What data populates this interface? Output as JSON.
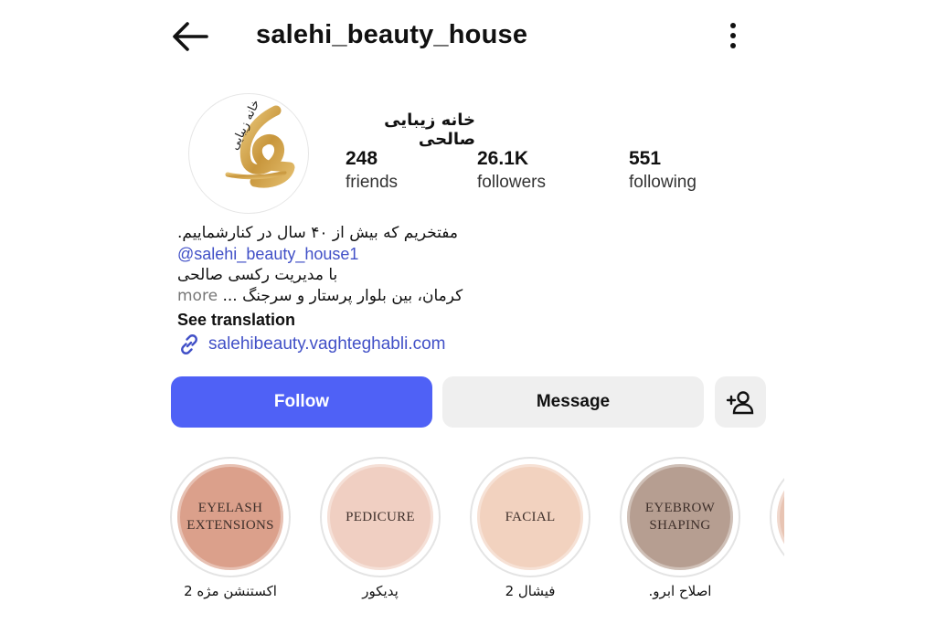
{
  "header": {
    "username": "salehi_beauty_house",
    "back_icon": "arrow-left-icon",
    "more_icon": "vertical-dots-icon"
  },
  "profile": {
    "full_name": "خانه زیبایی صالحی",
    "avatar_logo_text": "خانه زیبایی",
    "stats": [
      {
        "value": "248",
        "label": "friends"
      },
      {
        "value": "26.1K",
        "label": "followers"
      },
      {
        "value": "551",
        "label": "following"
      }
    ]
  },
  "bio": {
    "line1": "مفتخریم که بیش از ۴۰ سال در کنارشماییم.",
    "mention": "@salehi_beauty_house1",
    "line3": "با مدیریت رکسی صالحی",
    "line4": "کرمان، بین بلوار پرستار و سرجنگ ...",
    "more": "more",
    "see_translation": "See translation",
    "website": "salehibeauty.vaghteghabli.com"
  },
  "actions": {
    "follow": "Follow",
    "message": "Message",
    "add_icon": "person-add-icon"
  },
  "highlights": [
    {
      "cover_line1": "EYELASH",
      "cover_line2": "EXTENSIONS",
      "label": "اکستنشن مژه 2",
      "color": "#dba08b"
    },
    {
      "cover_line1": "PEDICURE",
      "cover_line2": "",
      "label": "پدیکور",
      "color": "#f0cfc2"
    },
    {
      "cover_line1": "FACIAL",
      "cover_line2": "",
      "label": "فیشال 2",
      "color": "#f2d2bf"
    },
    {
      "cover_line1": "EYEBROW",
      "cover_line2": "SHAPING",
      "label": "اصلاح ابرو.",
      "color": "#b69e91"
    }
  ],
  "colors": {
    "follow_button": "#4f61f6",
    "link": "#4150c7",
    "secondary_button": "#efefef"
  }
}
